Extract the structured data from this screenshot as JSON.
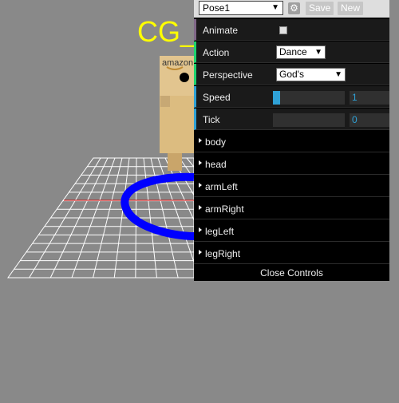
{
  "scene": {
    "title": "CG_H",
    "box_label": "amazon"
  },
  "gui": {
    "preset": {
      "selected": "Pose1",
      "save_label": "Save",
      "new_label": "New"
    },
    "controllers": {
      "animate": {
        "label": "Animate",
        "checked": false
      },
      "action": {
        "label": "Action",
        "value": "Dance"
      },
      "perspective": {
        "label": "Perspective",
        "value": "God's"
      },
      "speed": {
        "label": "Speed",
        "value": "1",
        "level": 0.1
      },
      "tick": {
        "label": "Tick",
        "value": "0",
        "level": 0
      }
    },
    "folders": [
      "body",
      "head",
      "armLeft",
      "armRight",
      "legLeft",
      "legRight"
    ],
    "close_label": "Close Controls"
  },
  "colors": {
    "background": "#898989",
    "title": "#ffff00",
    "ring": "#0000ff",
    "axis": "#cc0000",
    "grid": "#ffffff",
    "slider_accent": "#2fa1d6"
  }
}
